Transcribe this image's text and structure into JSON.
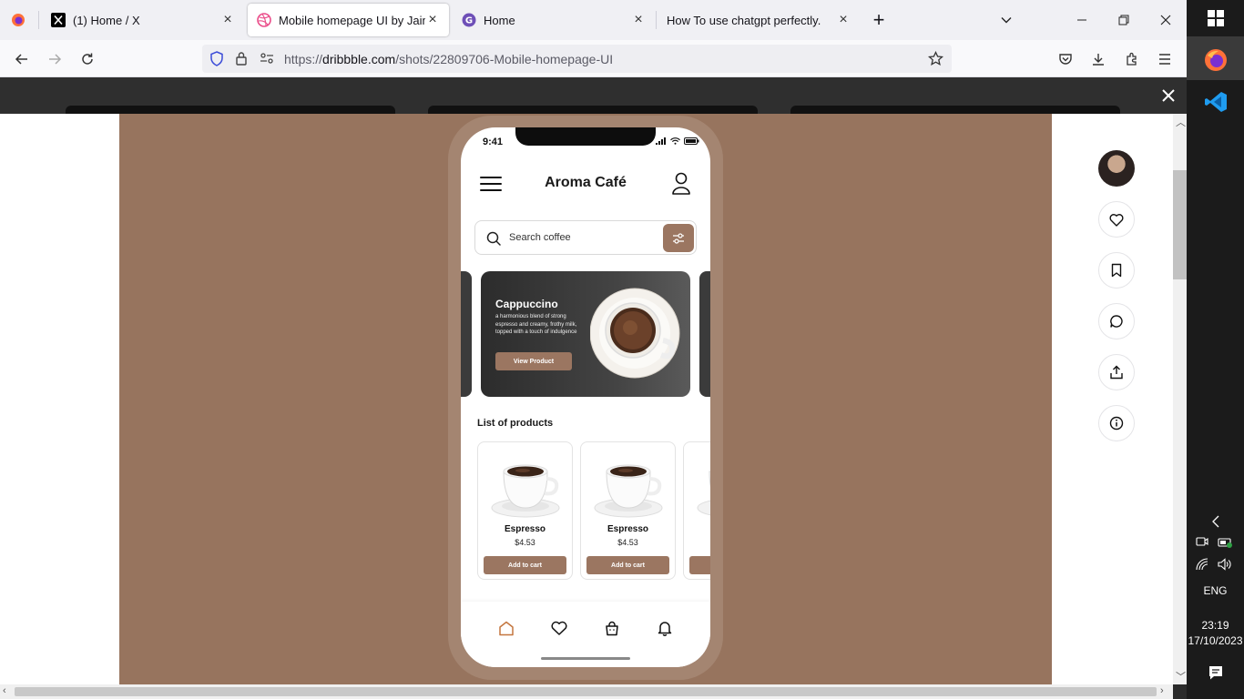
{
  "browser": {
    "tabs": [
      {
        "title": "",
        "icon": "firefox-icon"
      },
      {
        "title": "(1) Home / X",
        "icon": "x-logo-icon"
      },
      {
        "title": "Mobile homepage UI by Jaime",
        "icon": "dribbble-icon",
        "active": true
      },
      {
        "title": "Home",
        "icon": "grammarly-icon"
      },
      {
        "title": "How To use chatgpt perfectly.",
        "icon": ""
      }
    ],
    "url_prefix": "https://",
    "url_domain": "dribbble.com",
    "url_path": "/shots/22809706-Mobile-homepage-UI"
  },
  "app": {
    "time": "9:41",
    "title": "Aroma Café",
    "search_placeholder": "Search coffee",
    "banner": {
      "title": "Cappuccino",
      "description": "a harmonious blend of strong espresso and creamy, frothy milk, topped with a touch of indulgence",
      "button": "View Product"
    },
    "list_title": "List of products",
    "products": [
      {
        "name": "Espresso",
        "price": "$4.53",
        "button": "Add to cart"
      },
      {
        "name": "Espresso",
        "price": "$4.53",
        "button": "Add to cart"
      }
    ],
    "nav": [
      "home-icon",
      "heart-icon",
      "bag-icon",
      "bell-icon"
    ]
  },
  "colors": {
    "accent": "#9b7661",
    "shot_background": "#97745e",
    "frame": "#a48571",
    "home_active": "#c4763f"
  },
  "rail": [
    "avatar",
    "like-icon",
    "bookmark-icon",
    "comment-icon",
    "share-icon",
    "info-icon"
  ],
  "taskbar": {
    "language": "ENG",
    "time": "23:19",
    "date": "17/10/2023"
  }
}
